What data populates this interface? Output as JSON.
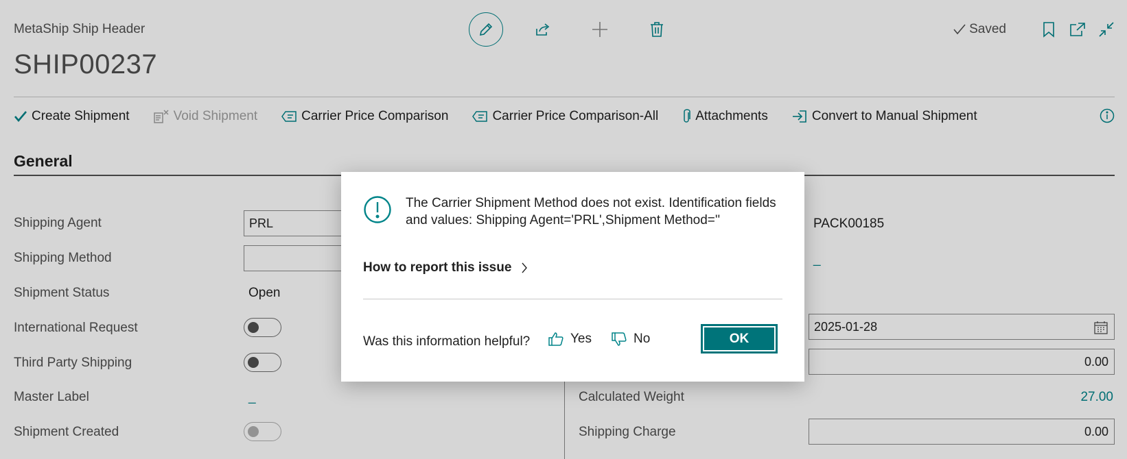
{
  "header": {
    "breadcrumb": "MetaShip Ship Header",
    "title": "SHIP00237",
    "saved_label": "Saved"
  },
  "toolbar": {
    "icons": [
      "edit-pencil-icon",
      "share-icon",
      "new-plus-icon",
      "delete-trash-icon"
    ],
    "right_icons": [
      "bookmark-icon",
      "open-new-window-icon",
      "collapse-icon"
    ]
  },
  "actions": [
    {
      "label": "Create Shipment",
      "icon": "checkmark-icon",
      "enabled": true
    },
    {
      "label": "Void Shipment",
      "icon": "void-document-icon",
      "enabled": false
    },
    {
      "label": "Carrier Price Comparison",
      "icon": "price-tag-icon",
      "enabled": true
    },
    {
      "label": "Carrier Price Comparison-All",
      "icon": "price-tag-icon",
      "enabled": true
    },
    {
      "label": "Attachments",
      "icon": "paperclip-icon",
      "enabled": true
    },
    {
      "label": "Convert to Manual Shipment",
      "icon": "convert-arrow-icon",
      "enabled": true
    }
  ],
  "general": {
    "section_title": "General",
    "left": {
      "shipping_agent": {
        "label": "Shipping Agent",
        "value": "PRL"
      },
      "shipping_method": {
        "label": "Shipping Method",
        "value": ""
      },
      "shipment_status": {
        "label": "Shipment Status",
        "value": "Open"
      },
      "international_request": {
        "label": "International Request",
        "value": false
      },
      "third_party_shipping": {
        "label": "Third Party Shipping",
        "value": false
      },
      "master_label": {
        "label": "Master Label",
        "value": "_"
      },
      "shipment_created": {
        "label": "Shipment Created",
        "value": false
      }
    },
    "right": {
      "package_no": {
        "value": "PACK00185"
      },
      "link_dash": {
        "value": "_"
      },
      "shipment_date": {
        "value": "2025-01-28"
      },
      "weight_field": {
        "value": "0.00"
      },
      "calculated_weight": {
        "label": "Calculated Weight",
        "value": "27.00"
      },
      "shipping_charge": {
        "label": "Shipping Charge",
        "value": "0.00"
      }
    }
  },
  "dialog": {
    "message": "The Carrier Shipment Method does not exist. Identification fields and values: Shipping Agent='PRL',Shipment Method=''",
    "report_link": "How to report this issue",
    "helpful_question": "Was this information helpful?",
    "yes_label": "Yes",
    "no_label": "No",
    "ok_label": "OK"
  },
  "colors": {
    "accent": "#008489",
    "ok_button": "#00747a"
  }
}
